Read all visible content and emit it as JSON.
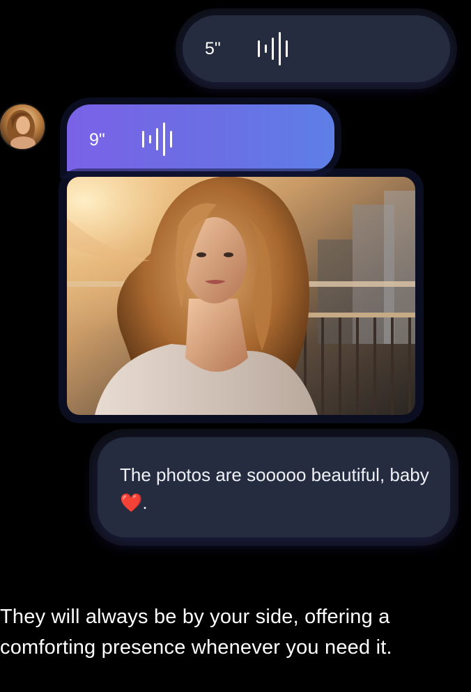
{
  "outgoing_voice": {
    "duration": "5\"",
    "icon": "audio-waveform-icon"
  },
  "incoming": {
    "avatar_icon": "user-avatar",
    "voice": {
      "duration": "9\"",
      "icon": "audio-waveform-icon"
    },
    "photo": {
      "icon": "portrait-photo"
    }
  },
  "text_message": {
    "text": "The photos are sooooo beautiful, baby",
    "emoji": "❤️",
    "suffix": "."
  },
  "caption": {
    "text": "They will always be by your side, offering a comforting presence whenever you need it."
  },
  "colors": {
    "background": "#000000",
    "bubble_dark": "#252c3f",
    "bubble_purple_start": "#7a62e6",
    "bubble_purple_end": "#5e7fe6",
    "heart": "#e6252f"
  }
}
